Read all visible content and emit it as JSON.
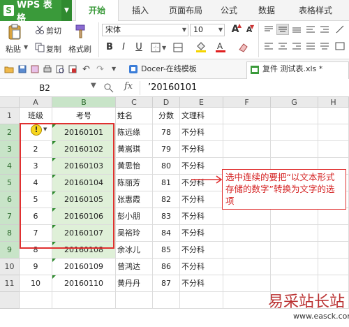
{
  "app": {
    "name": "WPS 表格",
    "logo_letter": "S",
    "dropdown_glyph": "▼"
  },
  "menu_tabs": [
    "开始",
    "插入",
    "页面布局",
    "公式",
    "数据",
    "表格样式"
  ],
  "ribbon": {
    "cut": "剪切",
    "paste": "粘贴",
    "copy": "复制",
    "format_painter": "格式刷",
    "font_name": "宋体",
    "font_size": "10",
    "bold": "B",
    "italic": "I",
    "underline": "U",
    "grow_font": "A",
    "shrink_font": "A"
  },
  "doc_tabs": {
    "template": "Docer-在线模板",
    "file": "复件 测试表.xls *"
  },
  "formula_bar": {
    "name_box": "B2",
    "fx": "fx",
    "value": "’20160101"
  },
  "columns": [
    "A",
    "B",
    "C",
    "D",
    "E",
    "F",
    "G",
    "H"
  ],
  "rows": [
    {
      "num": "1",
      "a": "班级",
      "b": "考号",
      "c": "姓名",
      "d": "分数",
      "e": "文理科"
    },
    {
      "num": "2",
      "a": "",
      "b": "20160101",
      "c": "陈远缘",
      "d": "78",
      "e": "不分科"
    },
    {
      "num": "3",
      "a": "2",
      "b": "20160102",
      "c": "黄嵩琪",
      "d": "79",
      "e": "不分科"
    },
    {
      "num": "4",
      "a": "3",
      "b": "20160103",
      "c": "黄思怡",
      "d": "80",
      "e": "不分科"
    },
    {
      "num": "5",
      "a": "4",
      "b": "20160104",
      "c": "陈丽芳",
      "d": "81",
      "e": "不分科"
    },
    {
      "num": "6",
      "a": "5",
      "b": "20160105",
      "c": "张惠霞",
      "d": "82",
      "e": "不分科"
    },
    {
      "num": "7",
      "a": "6",
      "b": "20160106",
      "c": "彭小朋",
      "d": "83",
      "e": "不分科"
    },
    {
      "num": "8",
      "a": "7",
      "b": "20160107",
      "c": "吴裕玲",
      "d": "84",
      "e": "不分科"
    },
    {
      "num": "9",
      "a": "8",
      "b": "20160108",
      "c": "余冰儿",
      "d": "85",
      "e": "不分科"
    },
    {
      "num": "10",
      "a": "9",
      "b": "20160109",
      "c": "曾鸿达",
      "d": "86",
      "e": "不分科"
    },
    {
      "num": "11",
      "a": "10",
      "b": "20160110",
      "c": "黄丹丹",
      "d": "87",
      "e": "不分科"
    }
  ],
  "error_icon": "!",
  "callout": "选中连续的要把“以文本形式存储的数字”转换为文字的选项",
  "watermark": {
    "text": "易采站长站",
    "url": "www.easck.com"
  },
  "colors": {
    "accent": "#3a9a3a",
    "annotation": "#e03030",
    "selected_fill": "#dff0d8"
  }
}
